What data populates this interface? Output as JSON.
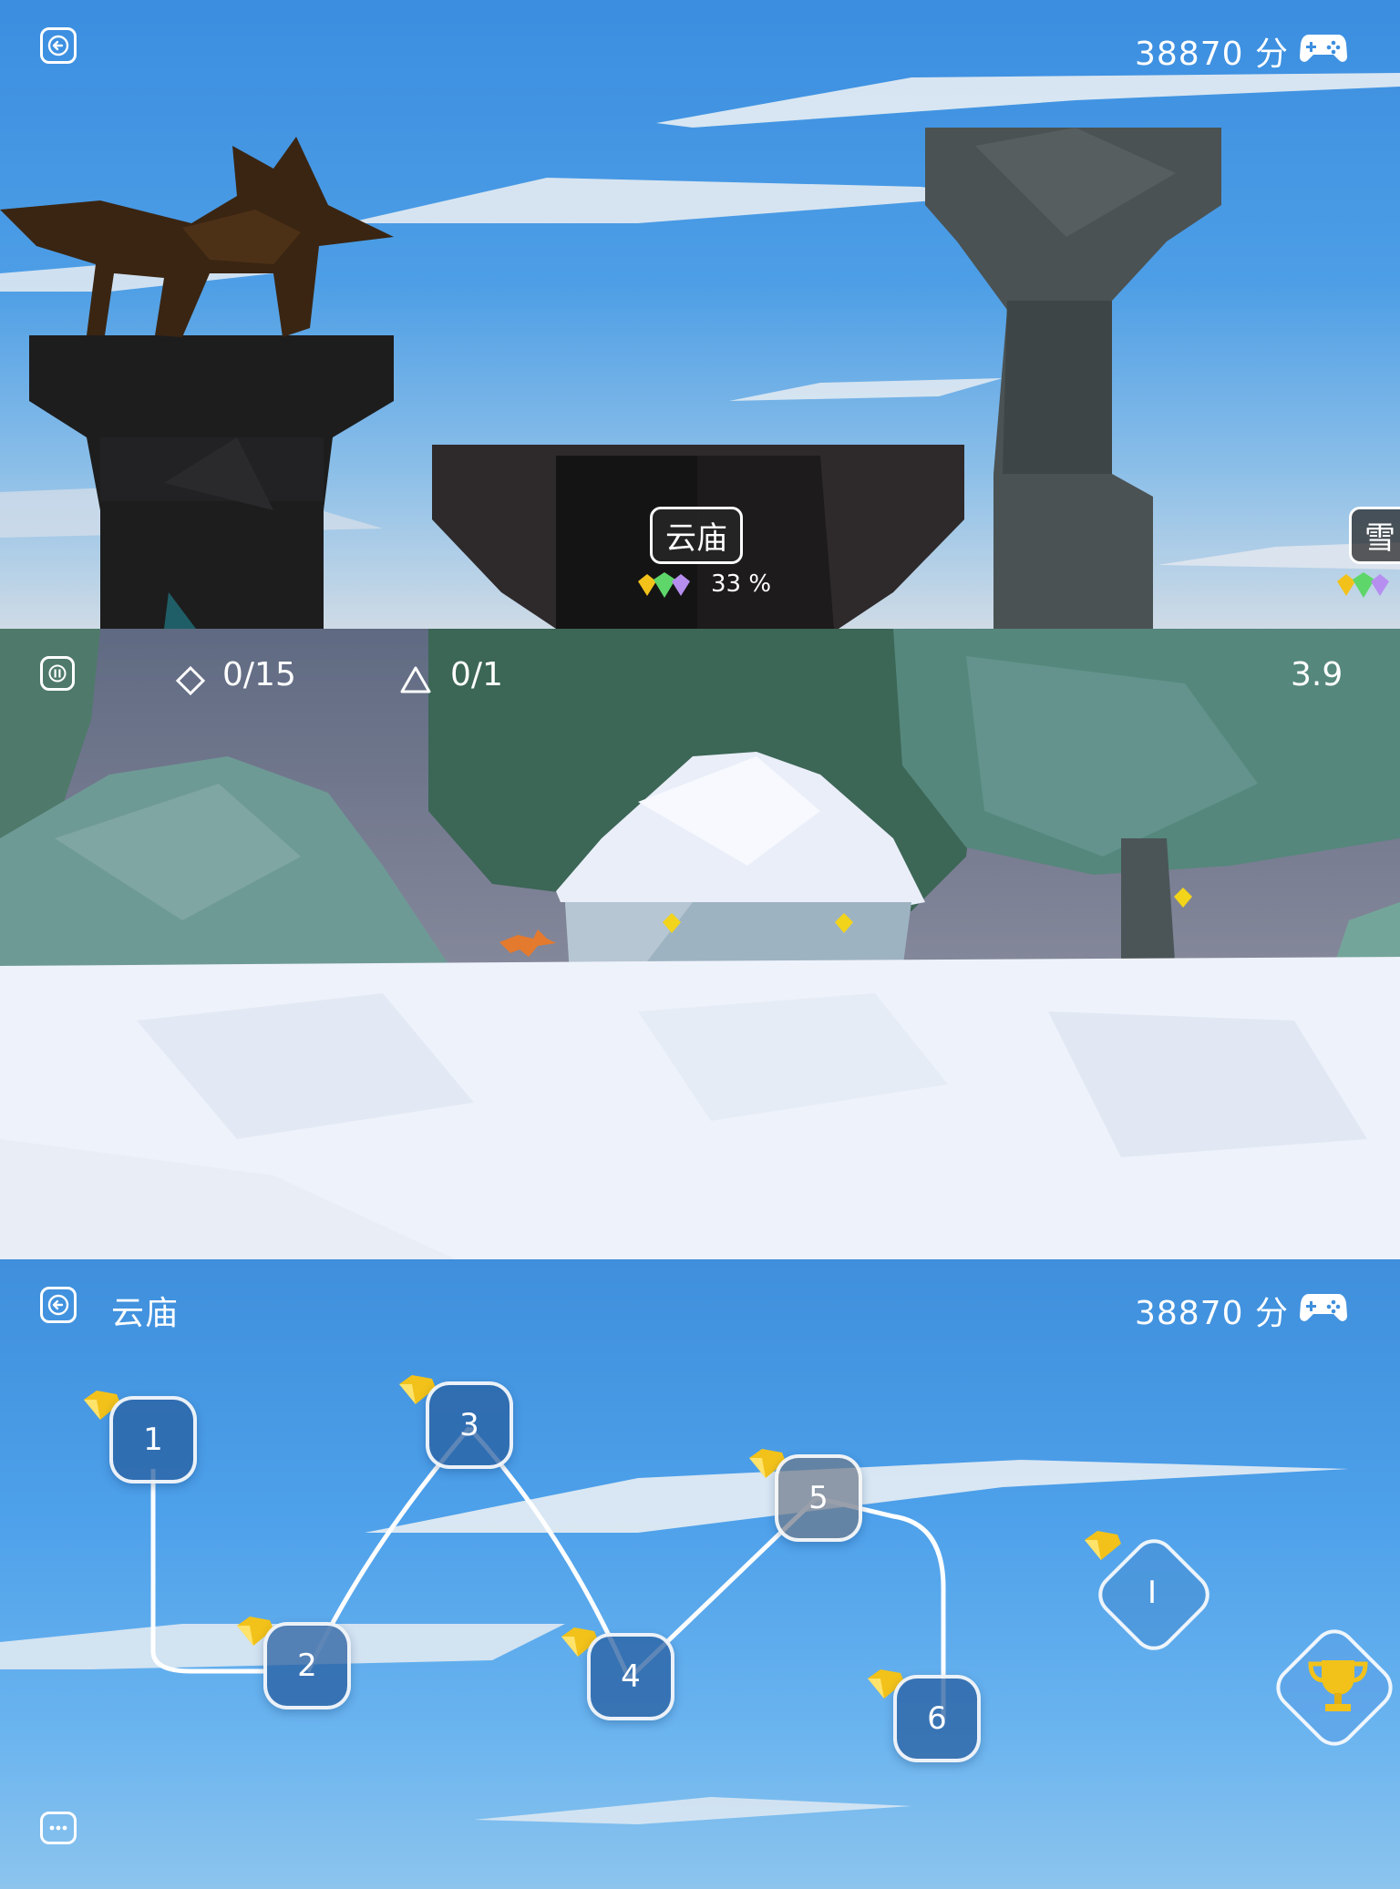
{
  "world_select": {
    "score": "38870 分",
    "world_name": "云庙",
    "world_percent": "33 %",
    "next_world_partial": "雪"
  },
  "gameplay": {
    "gems_counter": "0/15",
    "secrets_counter": "0/1",
    "timer": "3.9"
  },
  "level_map": {
    "title": "云庙",
    "score": "38870 分",
    "levels": [
      {
        "label": "1"
      },
      {
        "label": "2"
      },
      {
        "label": "3"
      },
      {
        "label": "4"
      },
      {
        "label": "5"
      },
      {
        "label": "6"
      }
    ],
    "bonus_level_label": "I"
  },
  "icons": {
    "back": "arrow-left-icon",
    "gamepad": "gamepad-icon",
    "pause": "pause-icon",
    "gem_outline": "diamond-outline-icon",
    "triangle_outline": "triangle-outline-icon",
    "trophy": "trophy-icon",
    "chat": "chat-bubble-icon",
    "gem": "yellow-gem-icon"
  },
  "colors": {
    "sky": "#3f8fdc",
    "gem_yellow": "#f2c21a",
    "gem_green": "#5ed66a",
    "gem_purple": "#b68ef0"
  }
}
